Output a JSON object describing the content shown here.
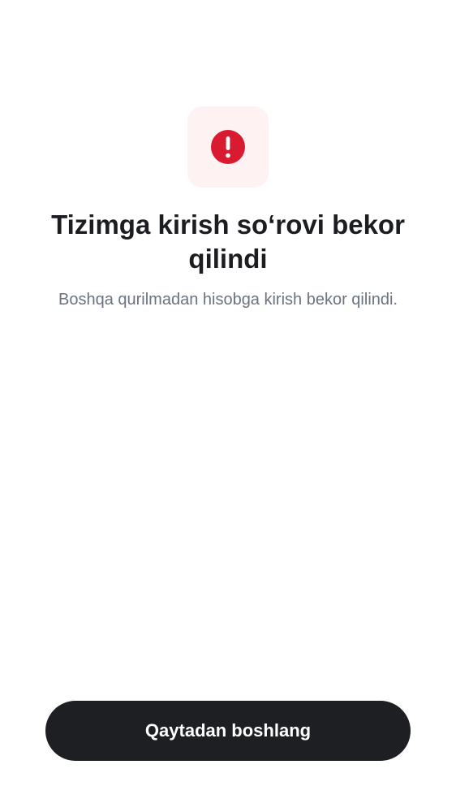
{
  "status_icon": {
    "name": "error-exclamation-icon",
    "badge_background": "#fff2f2",
    "icon_color": "#d81b30"
  },
  "content": {
    "title": "Tizimga kirish so‘rovi bekor qilindi",
    "subtitle": "Boshqa qurilmadan hisobga kirish bekor qilindi."
  },
  "actions": {
    "restart_label": "Qaytadan boshlang"
  },
  "colors": {
    "title_text": "#1c1d21",
    "subtitle_text": "#6b7280",
    "button_background": "#1e1f23",
    "button_text": "#ffffff"
  }
}
